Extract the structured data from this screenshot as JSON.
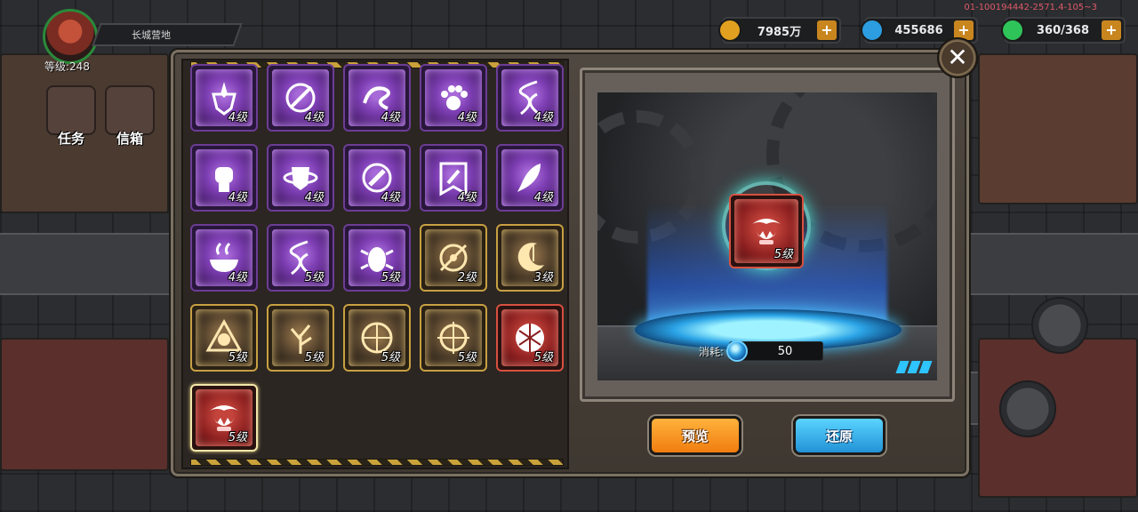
{
  "hud": {
    "player_name": "长城营地",
    "player_level": "等级:248",
    "debug_text": "01-100194442-2571.4-105~3",
    "side_buttons": [
      {
        "label": "任务",
        "icon": "scroll-icon"
      },
      {
        "label": "信箱",
        "icon": "mail-icon"
      }
    ],
    "resources": [
      {
        "value": "7985万",
        "icon": "gold-coin-icon",
        "color": "#e2a020"
      },
      {
        "value": "455686",
        "icon": "blue-gem-icon",
        "color": "#2b9de0"
      },
      {
        "value": "360/368",
        "icon": "green-energy-icon",
        "color": "#2fc45a"
      }
    ]
  },
  "skills": [
    {
      "level": "4级",
      "rarity": "purple",
      "icon": "sword-shield-icon"
    },
    {
      "level": "4级",
      "rarity": "purple",
      "icon": "slash-orb-icon"
    },
    {
      "level": "4级",
      "rarity": "purple",
      "icon": "swirl-icon"
    },
    {
      "level": "4级",
      "rarity": "purple",
      "icon": "paw-icon"
    },
    {
      "level": "4级",
      "rarity": "purple",
      "icon": "dna-icon"
    },
    {
      "level": "4级",
      "rarity": "purple",
      "icon": "fist-icon"
    },
    {
      "level": "4级",
      "rarity": "purple",
      "icon": "shield-ring-icon"
    },
    {
      "level": "4级",
      "rarity": "purple",
      "icon": "wrench-cycle-icon"
    },
    {
      "level": "4级",
      "rarity": "purple",
      "icon": "wrench-banner-icon"
    },
    {
      "level": "4级",
      "rarity": "purple",
      "icon": "feather-icon"
    },
    {
      "level": "4级",
      "rarity": "purple",
      "icon": "steaming-bowl-icon"
    },
    {
      "level": "5级",
      "rarity": "purple",
      "icon": "dna-icon"
    },
    {
      "level": "5级",
      "rarity": "purple",
      "icon": "beetle-icon"
    },
    {
      "level": "2级",
      "rarity": "gold",
      "icon": "target-burst-icon"
    },
    {
      "level": "3级",
      "rarity": "gold",
      "icon": "crescent-moon-icon"
    },
    {
      "level": "5级",
      "rarity": "gold",
      "icon": "triangle-flower-icon"
    },
    {
      "level": "5级",
      "rarity": "gold",
      "icon": "dead-tree-icon"
    },
    {
      "level": "5级",
      "rarity": "gold",
      "icon": "bow-icon"
    },
    {
      "level": "5级",
      "rarity": "gold",
      "icon": "crosshair-icon"
    },
    {
      "level": "5级",
      "rarity": "red",
      "icon": "net-crest-icon"
    },
    {
      "level": "5级",
      "rarity": "red",
      "icon": "fanged-mouth-icon"
    }
  ],
  "preview": {
    "level": "5级",
    "icon": "fanged-mouth-icon",
    "cost_label": "消耗:",
    "cost_value": "50",
    "cost_icon": "blue-gem-icon"
  },
  "buttons": {
    "preview": "预览",
    "restore": "还原"
  },
  "colors": {
    "purple_frame": "#6c3d95",
    "gold_frame": "#c8a042",
    "red_frame": "#d85040",
    "orange_button": "#f07d0e",
    "blue_button": "#2292d6"
  }
}
